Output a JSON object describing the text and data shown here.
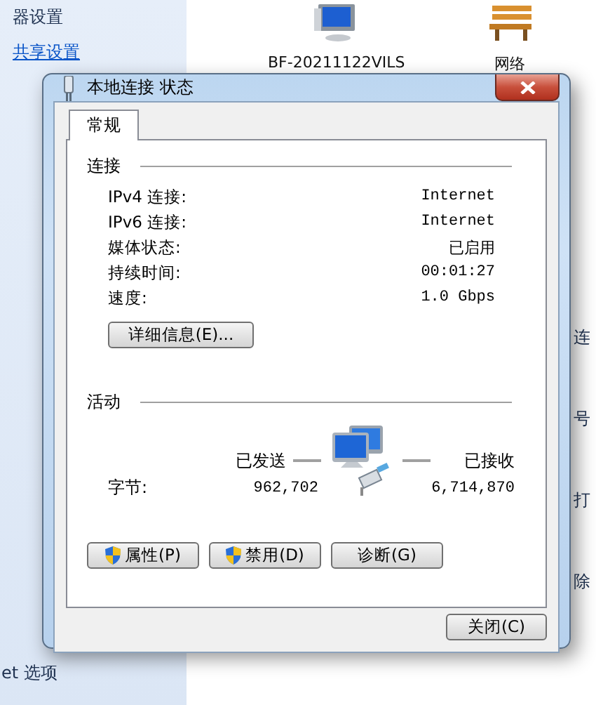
{
  "background": {
    "sidebar": [
      {
        "text": "器设置",
        "kind": "text"
      },
      {
        "text": "共享设置",
        "kind": "link"
      }
    ],
    "bottom_sidebar": [
      {
        "text": "et 选项"
      }
    ],
    "devices": [
      {
        "label": "BF-20211122VILS",
        "kind": "computer"
      },
      {
        "label": "网络",
        "kind": "bench"
      }
    ],
    "right_fragments": [
      {
        "text": "连"
      },
      {
        "text": "号"
      },
      {
        "text": "打"
      },
      {
        "text": "除"
      }
    ]
  },
  "dialog": {
    "title": "本地连接 状态",
    "tabs": [
      {
        "label": "常规",
        "selected": true
      }
    ],
    "connection": {
      "heading": "连接",
      "rows": [
        {
          "label": "IPv4 连接:",
          "value": "Internet"
        },
        {
          "label": "IPv6 连接:",
          "value": "Internet"
        },
        {
          "label": "媒体状态:",
          "value": "已启用"
        },
        {
          "label": "持续时间:",
          "value": "00:01:27"
        },
        {
          "label": "速度:",
          "value": "1.0 Gbps"
        }
      ],
      "details_button": "详细信息(E)..."
    },
    "activity": {
      "heading": "活动",
      "sent_label": "已发送",
      "received_label": "已接收",
      "bytes_label": "字节:",
      "sent": "962,702",
      "received": "6,714,870"
    },
    "buttons": [
      {
        "label": "属性(P)",
        "shield": true
      },
      {
        "label": "禁用(D)",
        "shield": true
      },
      {
        "label": "诊断(G)",
        "shield": false
      }
    ],
    "close_button": "关闭(C)"
  }
}
